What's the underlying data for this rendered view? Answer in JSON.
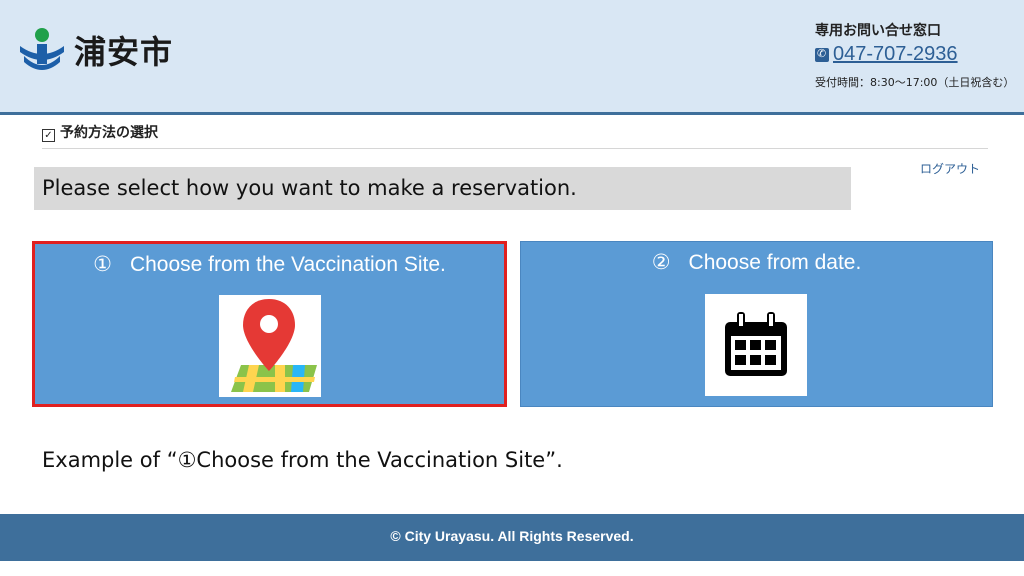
{
  "header": {
    "logo_text": "浦安市",
    "contact_title": "専用お問い合せ窓口",
    "phone": "047-707-2936",
    "hours": "受付時間：8:30～17:00（土日祝含む）"
  },
  "section": {
    "title": "予約方法の選択",
    "logout": "ログアウト"
  },
  "banner": "Please select how you want to make a reservation.",
  "options": [
    {
      "number": "①",
      "label": "Choose from the Vaccination Site.",
      "icon": "map-pin-icon",
      "selected": true
    },
    {
      "number": "②",
      "label": "Choose from date.",
      "icon": "calendar-icon",
      "selected": false
    }
  ],
  "example_text": "Example of “①Choose from the Vaccination Site”.",
  "footer": "© City Urayasu. All Rights Reserved.",
  "colors": {
    "header_bg": "#d9e7f4",
    "accent": "#3e6f9b",
    "card_bg": "#5b9bd5",
    "selected_border": "#e02020",
    "banner_bg": "#d9d9d9"
  }
}
